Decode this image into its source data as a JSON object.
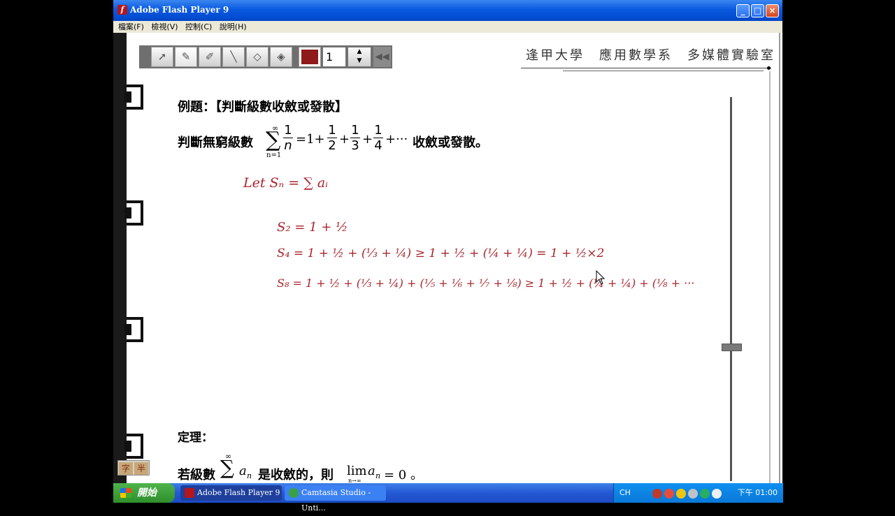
{
  "window": {
    "title": "Adobe Flash Player 9",
    "app_icon": "f",
    "minimize": "_",
    "maximize": "□",
    "close": "×"
  },
  "menubar": {
    "items": [
      "檔案(F)",
      "檢視(V)",
      "控制(C)",
      "說明(H)"
    ]
  },
  "toolbar": {
    "page_number": "1",
    "pen_color": "#8e1a1a",
    "tools": [
      "arrow-icon",
      "pencil-icon",
      "highlighter-icon",
      "line-icon",
      "eraser-icon",
      "clear-eraser-icon"
    ],
    "spin_up": "▲",
    "spin_down": "▼",
    "rewind": "◀◀"
  },
  "header": {
    "text": "逢甲大學　應用數學系　多媒體實驗室"
  },
  "lesson": {
    "example_title": "例題：【判斷級數收斂或發散】",
    "question_prefix": "判斷無窮級數",
    "question_suffix": "收斂或發散。",
    "theorem_label": "定理：",
    "theorem_prefix": "若級數",
    "theorem_middle": "是收斂的，則",
    "theorem_result": "= 0 。",
    "math": {
      "sum_top": "∞",
      "sum_bottom": "n=1",
      "sigma": "∑",
      "frac_num": "1",
      "frac_den_n": "n",
      "eq_one": "=1+",
      "plus": "+",
      "tail": "+···",
      "d2": "2",
      "d3": "3",
      "d4": "4",
      "an": "a",
      "sub_n": "n",
      "lim": "lim",
      "lim_sub": "n→∞"
    }
  },
  "handwriting": {
    "color": "#a8242c",
    "line1": "Let  Sₙ = ∑ aᵢ",
    "line2": "S₂ = 1 + ½",
    "line3": "S₄ = 1 + ½ + (⅓ + ¼) ≥ 1 + ½ + (¼ + ¼) = 1 + ½×2",
    "line4": "S₈ = 1 + ½ + (⅓ + ¼) + (⅕ + ⅙ + ⅐ + ⅛) ≥ 1 + ½ + (¼ + ¼) + (⅛ + ···"
  },
  "ime": {
    "left": "字",
    "right": "半"
  },
  "taskbar": {
    "start": "開始",
    "items": [
      {
        "label": "Adobe Flash Player 9",
        "active": true
      },
      {
        "label": "Camtasia Studio - Unti...",
        "active": false
      }
    ],
    "tray_lang": "CH",
    "clock": "下午 01:00"
  }
}
